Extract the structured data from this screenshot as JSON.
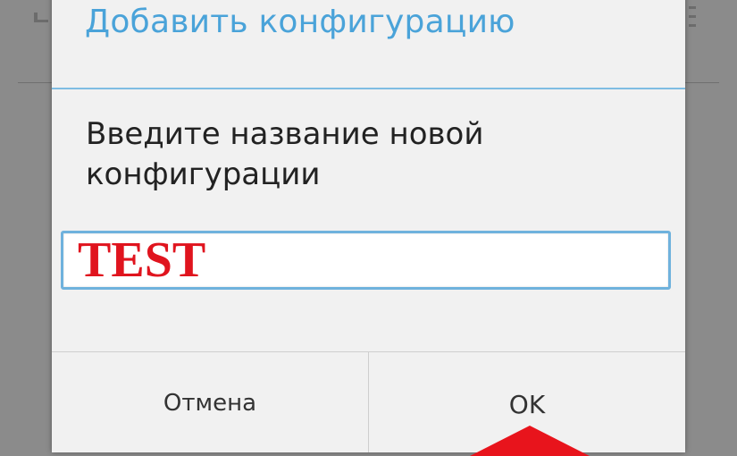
{
  "dialog": {
    "title": "Добавить конфигурацию",
    "message": "Введите название новой конфигурации",
    "input_value": "TEST",
    "cancel_label": "Отмена",
    "ok_label": "OK"
  },
  "background": {
    "left_icon": "share-icon",
    "right_icon": "overflow-menu-icon"
  },
  "annotation": {
    "icon": "arrow-up-icon",
    "color": "#e8141c"
  },
  "colors": {
    "accent": "#4aa3d9",
    "input_text": "#e0141e",
    "dialog_bg": "#f1f1f1"
  }
}
